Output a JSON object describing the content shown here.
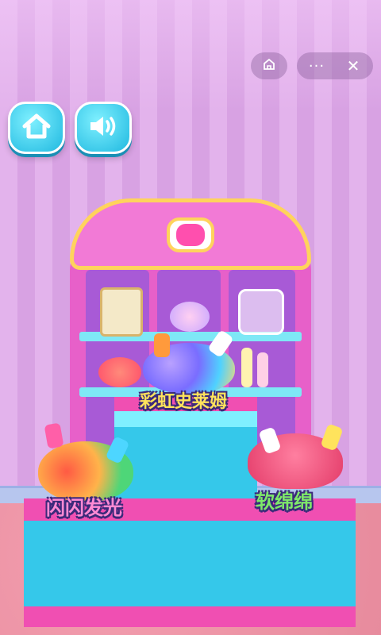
{
  "top_controls": {
    "home_icon": "house-icon",
    "more_icon": "ellipsis-icon",
    "close_icon": "close-icon",
    "more_glyph": "···",
    "close_glyph": "✕"
  },
  "game_buttons": {
    "home_icon": "house-icon",
    "sound_icon": "speaker-icon"
  },
  "products": {
    "rainbow": {
      "label": "彩虹史莱姆"
    },
    "glitter": {
      "label": "闪闪发光"
    },
    "fluffy": {
      "label": "软绵绵"
    }
  },
  "colors": {
    "accent_cyan": "#35c8ea",
    "accent_pink": "#f04fb2",
    "wall": "#e3b3ec",
    "floor": "#e78b9d"
  }
}
